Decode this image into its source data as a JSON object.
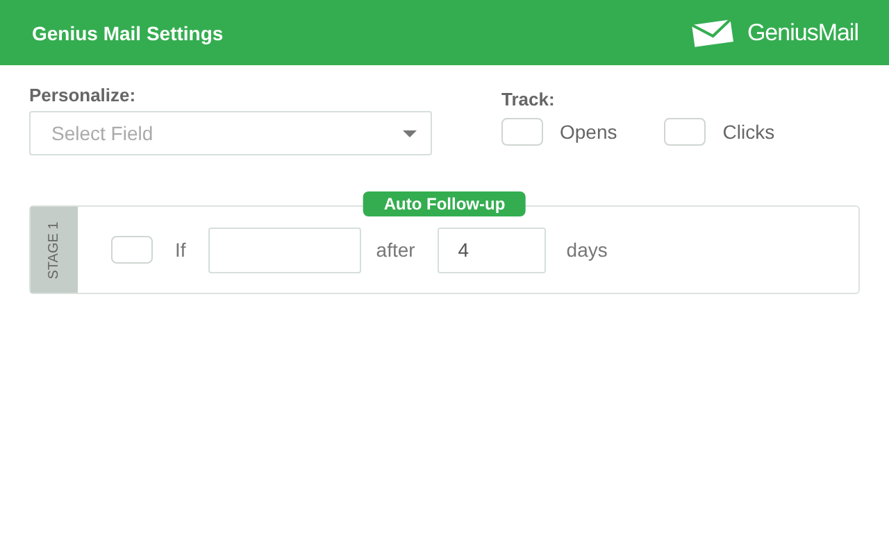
{
  "header": {
    "title": "Genius Mail Settings",
    "logo_text": "GeniusMail"
  },
  "personalize": {
    "label": "Personalize:",
    "placeholder": "Select Field"
  },
  "track": {
    "label": "Track:",
    "options": [
      {
        "label": "Opens",
        "checked": false
      },
      {
        "label": "Clicks",
        "checked": false
      }
    ]
  },
  "stage": {
    "badge": "Auto Follow-up",
    "side_label": "STAGE 1",
    "checked": false,
    "if_label": "If",
    "after_label": "after",
    "days_value": "4",
    "days_label": "days"
  }
}
